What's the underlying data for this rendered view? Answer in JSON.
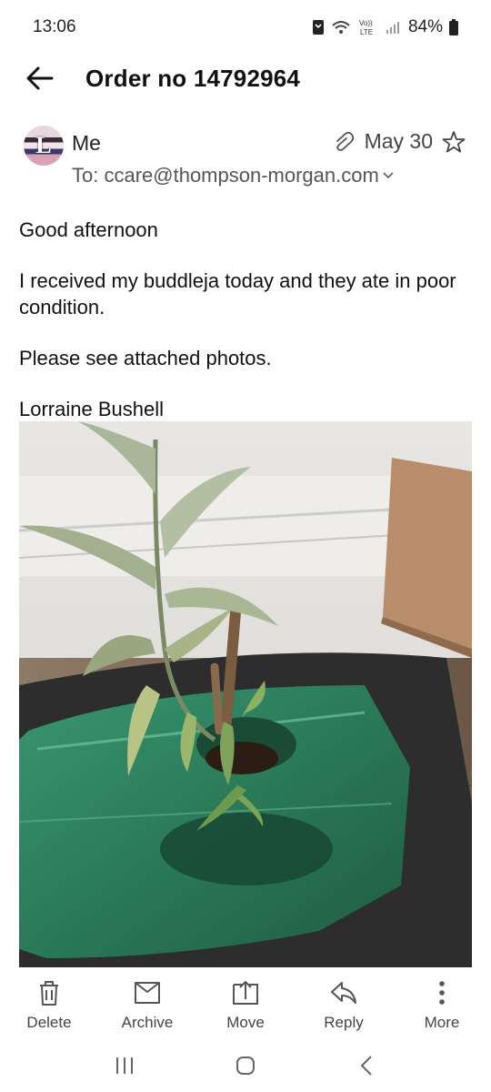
{
  "status_bar": {
    "time": "13:06",
    "battery": "84%"
  },
  "app_bar": {
    "subject": "Order no 14792964"
  },
  "message": {
    "avatar_letter": "L",
    "sender": "Me",
    "to": "To: ccare@thompson-morgan.com",
    "date": "May 30",
    "body": [
      "Good afternoon",
      "I received my buddleja today and they ate in poor condition.",
      "Please see attached photos.",
      "Lorraine Bushell"
    ]
  },
  "toolbar": {
    "delete": "Delete",
    "archive": "Archive",
    "move": "Move",
    "reply": "Reply",
    "more": "More"
  },
  "colors": {
    "text": "#111111",
    "icon": "#555555",
    "background": "#ffffff"
  }
}
